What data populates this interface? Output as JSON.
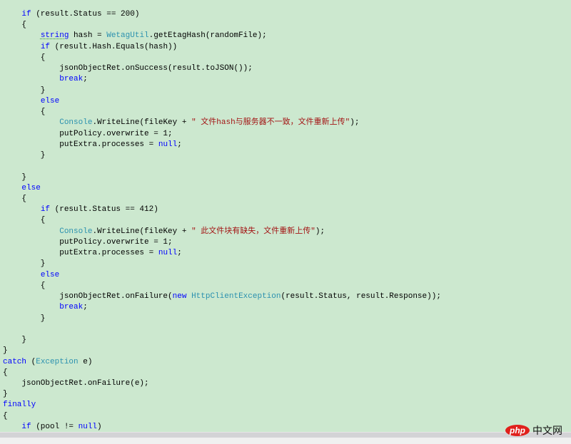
{
  "colors": {
    "keyword": "#0000ff",
    "type": "#2b91af",
    "string": "#a31515",
    "background": "#cce8cf"
  },
  "code_lines": [
    [
      [
        "p",
        "    "
      ],
      [
        "k",
        "if"
      ],
      [
        "p",
        " (result.Status == 200)"
      ]
    ],
    [
      [
        "p",
        "    {"
      ]
    ],
    [
      [
        "p",
        "        "
      ],
      [
        "kq",
        "string"
      ],
      [
        "p",
        " hash = "
      ],
      [
        "t",
        "WetagUtil"
      ],
      [
        "p",
        ".getEtagHash(randomFile);"
      ]
    ],
    [
      [
        "p",
        "        "
      ],
      [
        "k",
        "if"
      ],
      [
        "p",
        " (result.Hash.Equals(hash))"
      ]
    ],
    [
      [
        "p",
        "        {"
      ]
    ],
    [
      [
        "p",
        "            jsonObjectRet.onSuccess(result.toJSON());"
      ]
    ],
    [
      [
        "p",
        "            "
      ],
      [
        "k",
        "break"
      ],
      [
        "p",
        ";"
      ]
    ],
    [
      [
        "p",
        "        }"
      ]
    ],
    [
      [
        "p",
        "        "
      ],
      [
        "k",
        "else"
      ]
    ],
    [
      [
        "p",
        "        {"
      ]
    ],
    [
      [
        "p",
        "            "
      ],
      [
        "t",
        "Console"
      ],
      [
        "p",
        ".WriteLine(fileKey + "
      ],
      [
        "s",
        "\" 文件hash与服务器不一致，文件重新上传\""
      ],
      [
        "p",
        ");"
      ]
    ],
    [
      [
        "p",
        "            putPolicy.overwrite = 1;"
      ]
    ],
    [
      [
        "p",
        "            putExtra.processes = "
      ],
      [
        "k",
        "null"
      ],
      [
        "p",
        ";"
      ]
    ],
    [
      [
        "p",
        "        }"
      ]
    ],
    [
      [
        "p",
        ""
      ]
    ],
    [
      [
        "p",
        "    }"
      ]
    ],
    [
      [
        "p",
        "    "
      ],
      [
        "k",
        "else"
      ]
    ],
    [
      [
        "p",
        "    {"
      ]
    ],
    [
      [
        "p",
        "        "
      ],
      [
        "k",
        "if"
      ],
      [
        "p",
        " (result.Status == 412)"
      ]
    ],
    [
      [
        "p",
        "        {"
      ]
    ],
    [
      [
        "p",
        "            "
      ],
      [
        "t",
        "Console"
      ],
      [
        "p",
        ".WriteLine(fileKey + "
      ],
      [
        "s",
        "\" 此文件块有缺失，文件重新上传\""
      ],
      [
        "p",
        ");"
      ]
    ],
    [
      [
        "p",
        "            putPolicy.overwrite = 1;"
      ]
    ],
    [
      [
        "p",
        "            putExtra.processes = "
      ],
      [
        "k",
        "null"
      ],
      [
        "p",
        ";"
      ]
    ],
    [
      [
        "p",
        "        }"
      ]
    ],
    [
      [
        "p",
        "        "
      ],
      [
        "k",
        "else"
      ]
    ],
    [
      [
        "p",
        "        {"
      ]
    ],
    [
      [
        "p",
        "            jsonObjectRet.onFailure("
      ],
      [
        "k",
        "new"
      ],
      [
        "p",
        " "
      ],
      [
        "t",
        "HttpClientException"
      ],
      [
        "p",
        "(result.Status, result.Response));"
      ]
    ],
    [
      [
        "p",
        "            "
      ],
      [
        "k",
        "break"
      ],
      [
        "p",
        ";"
      ]
    ],
    [
      [
        "p",
        "        }"
      ]
    ],
    [
      [
        "p",
        ""
      ]
    ],
    [
      [
        "p",
        "    }"
      ]
    ],
    [
      [
        "p",
        "}"
      ]
    ],
    [
      [
        "k",
        "catch"
      ],
      [
        "p",
        " ("
      ],
      [
        "t",
        "Exception"
      ],
      [
        "p",
        " e)"
      ]
    ],
    [
      [
        "p",
        "{"
      ]
    ],
    [
      [
        "p",
        "    jsonObjectRet.onFailure(e);"
      ]
    ],
    [
      [
        "p",
        "}"
      ]
    ],
    [
      [
        "k",
        "finally"
      ]
    ],
    [
      [
        "p",
        "{"
      ]
    ],
    [
      [
        "p",
        "    "
      ],
      [
        "k",
        "if"
      ],
      [
        "p",
        " (pool != "
      ],
      [
        "k",
        "null"
      ],
      [
        "p",
        ")"
      ]
    ]
  ],
  "watermark": {
    "badge": "php",
    "text": "中文网"
  }
}
